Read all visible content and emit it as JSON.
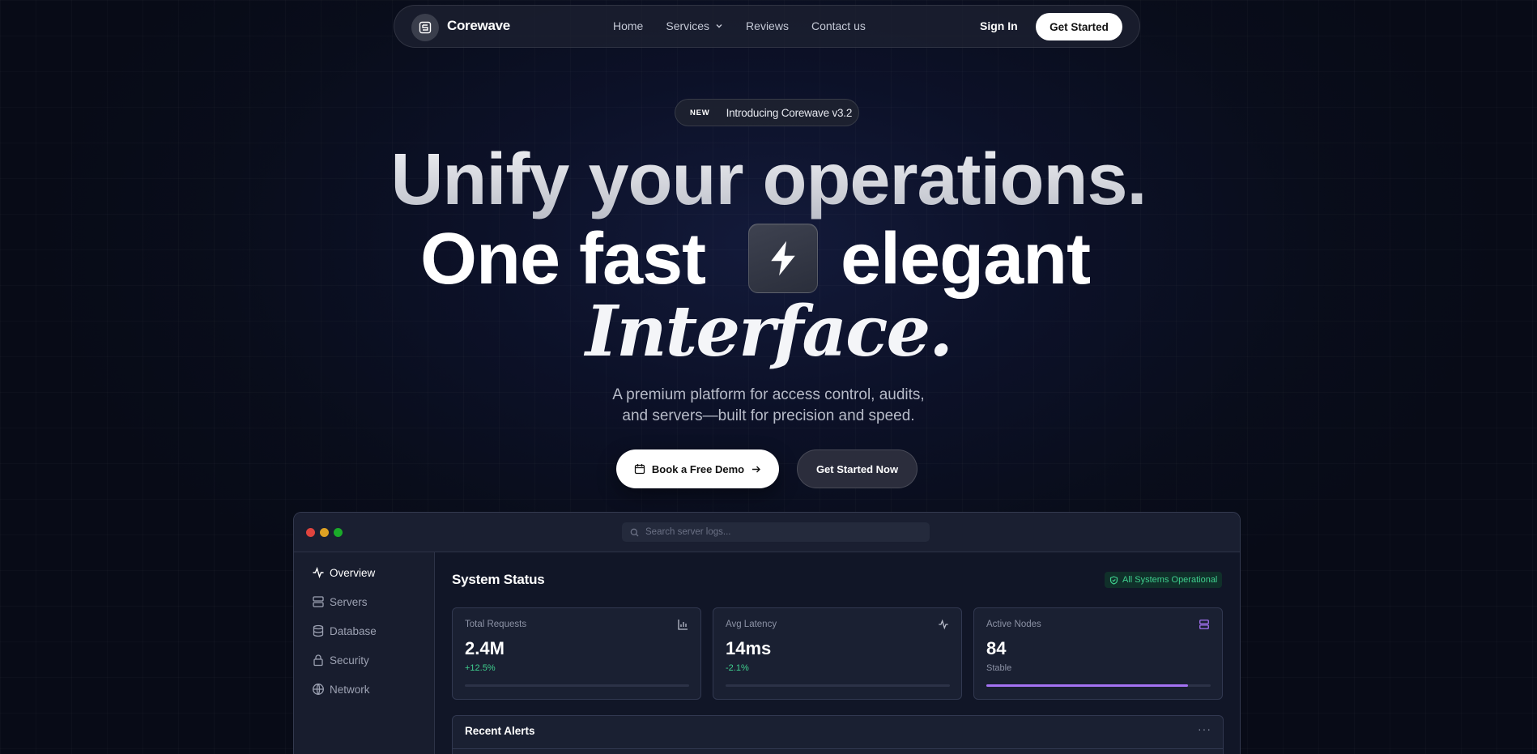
{
  "nav": {
    "brand": "Corewave",
    "links": [
      "Home",
      "Services",
      "Reviews",
      "Contact us"
    ],
    "sign_in": "Sign In",
    "get_started": "Get Started"
  },
  "hero": {
    "badge_tag": "NEW",
    "badge_text": "Introducing Corewave v3.2",
    "line1": "Unify your operations.",
    "line2_a": "One fast",
    "line2_b": "elegant",
    "line3": "Interface.",
    "subtitle_1": "A premium platform for access control, audits,",
    "subtitle_2": "and servers—built for precision and speed.",
    "cta_demo": "Book a Free Demo",
    "cta_start": "Get Started Now"
  },
  "dashboard": {
    "search_placeholder": "Search server logs...",
    "sidebar": [
      {
        "label": "Overview",
        "icon": "activity-icon",
        "active": true
      },
      {
        "label": "Servers",
        "icon": "server-icon",
        "active": false
      },
      {
        "label": "Database",
        "icon": "database-icon",
        "active": false
      },
      {
        "label": "Security",
        "icon": "lock-icon",
        "active": false
      },
      {
        "label": "Network",
        "icon": "globe-icon",
        "active": false
      }
    ],
    "title": "System Status",
    "status": "All Systems Operational",
    "cards": [
      {
        "label": "Total Requests",
        "value": "2.4M",
        "sub": "+12.5%",
        "icon": "bar-chart-icon",
        "progress": 0
      },
      {
        "label": "Avg Latency",
        "value": "14ms",
        "sub": "-2.1%",
        "icon": "activity-icon",
        "progress": 0
      },
      {
        "label": "Active Nodes",
        "value": "84",
        "sub": "Stable",
        "icon": "server-icon",
        "progress": 0.9
      }
    ],
    "alerts_title": "Recent Alerts"
  },
  "colors": {
    "accent_green": "#3fcf8e",
    "accent_purple": "#a472f2",
    "traffic_red": "#e0443e",
    "traffic_yellow": "#dea123",
    "traffic_green": "#1aab29"
  }
}
